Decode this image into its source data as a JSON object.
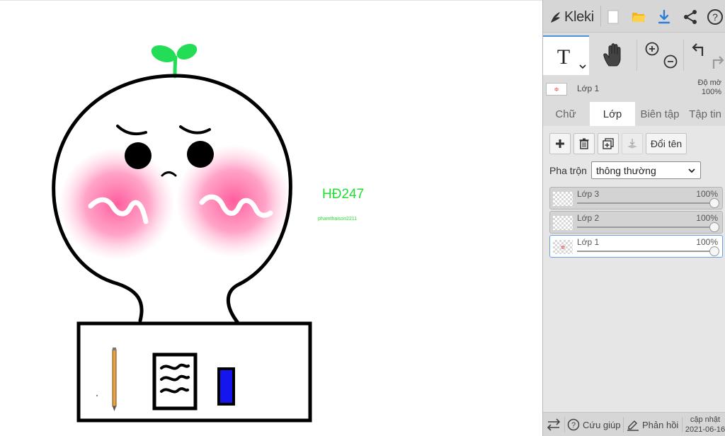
{
  "app": {
    "name": "Kleki"
  },
  "colors": {
    "accent": "#4a90e2",
    "sprout": "#22dd55",
    "canvas_text": "#22dd33",
    "eraser": "#1515ee",
    "blush": "#ff6fa8"
  },
  "canvas": {
    "title_text": "HĐ247",
    "signature_text": "phamthaison2211"
  },
  "layer_info": {
    "name": "Lớp 1",
    "opacity_label": "Độ mờ",
    "opacity_value": "100%"
  },
  "tabs": [
    {
      "label": "Chữ"
    },
    {
      "label": "Lớp"
    },
    {
      "label": "Biên tập"
    },
    {
      "label": "Tập tin"
    }
  ],
  "panel": {
    "rename_label": "Đổi tên",
    "blend_label": "Pha trộn",
    "blend_value": "thông thường"
  },
  "layers": [
    {
      "name": "Lớp 3",
      "opacity": "100%"
    },
    {
      "name": "Lớp 2",
      "opacity": "100%"
    },
    {
      "name": "Lớp 1",
      "opacity": "100%"
    }
  ],
  "bottom": {
    "help_label": "Cứu giúp",
    "feedback_label": "Phản hồi",
    "update_label": "cập nhật",
    "update_date": "2021-06-16"
  }
}
